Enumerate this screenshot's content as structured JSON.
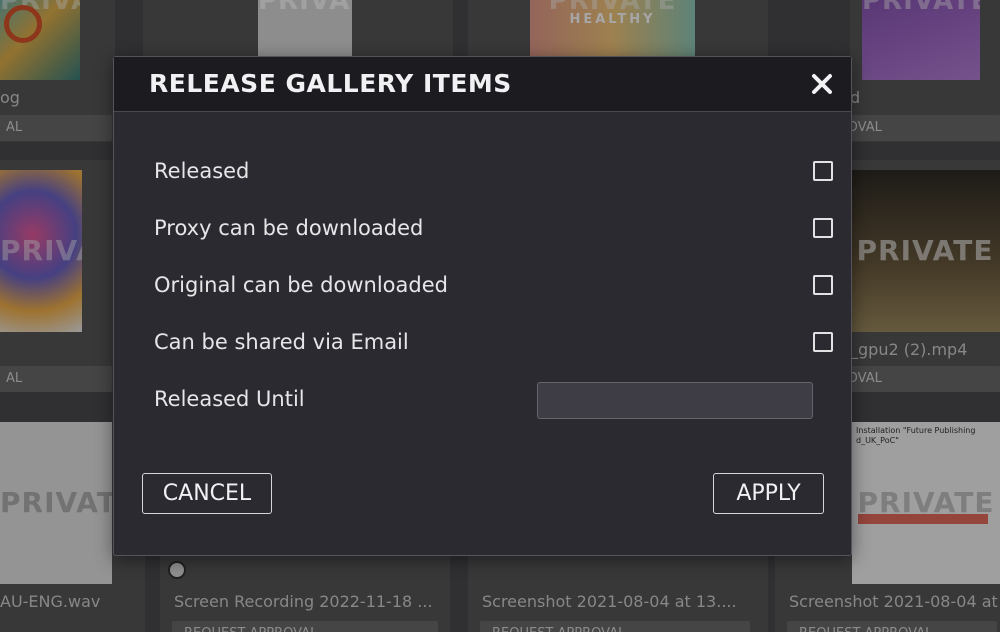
{
  "gallery": {
    "watermark": "PRIVATE",
    "healthy_text": "HEALTHY",
    "cards": [
      {
        "title": "og",
        "pill": "AL"
      },
      {
        "title": "d",
        "pill": "T APPROVAL"
      },
      {
        "title": "",
        "pill": "AL"
      },
      {
        "title": "_gpu2 (2).mp4",
        "pill": "T APPROVAL"
      },
      {
        "title": "AU-ENG.wav",
        "pill": ""
      },
      {
        "title": "Screen Recording 2022-11-18 ...",
        "pill": "REQUEST APPROVAL"
      },
      {
        "title": "Screenshot 2021-08-04 at 13....",
        "pill": "REQUEST APPROVAL"
      },
      {
        "title": "Screenshot 2021-08-04 at",
        "pill": "REQUEST APPROVAL"
      }
    ],
    "doc_thumb_lines": [
      "Installation \"Future Publishing",
      "d_UK_PoC\""
    ]
  },
  "modal": {
    "title": "RELEASE GALLERY ITEMS",
    "close_icon": "close-icon",
    "options": [
      {
        "label": "Released",
        "checked": false
      },
      {
        "label": "Proxy can be downloaded",
        "checked": false
      },
      {
        "label": "Original can be downloaded",
        "checked": false
      },
      {
        "label": "Can be shared via Email",
        "checked": false
      }
    ],
    "released_until": {
      "label": "Released Until",
      "value": "",
      "placeholder": ""
    },
    "cancel_label": "CANCEL",
    "apply_label": "APPLY"
  },
  "colors": {
    "modal_bg": "#2b2a31",
    "header_bg": "#1c1b20",
    "backdrop": "#4b4b4d"
  }
}
